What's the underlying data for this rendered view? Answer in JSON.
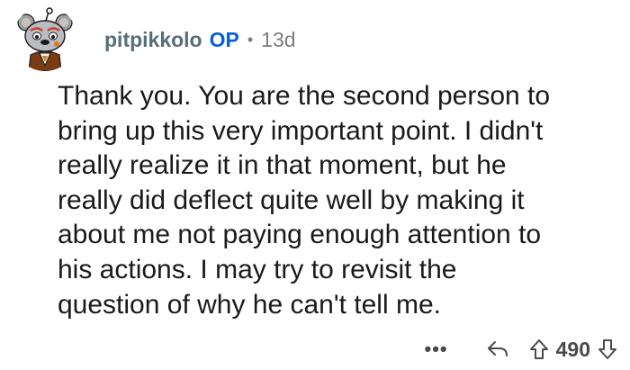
{
  "comment": {
    "author": "pitpikkolo",
    "op_badge": "OP",
    "separator": "•",
    "age": "13d",
    "body": "Thank you. You are the second person to\nbring up this very important point. I didn't\nreally realize it in that moment, but he\nreally did deflect quite well by making it\nabout me not paying enough attention to\nhis actions. I may try to revisit the\nquestion of why he can't tell me.",
    "avatar_icon": "snoo-avatar-icon"
  },
  "actions": {
    "more_label": "•••",
    "reply_icon": "reply-icon",
    "upvote_icon": "upvote-arrow-icon",
    "score": "490",
    "downvote_icon": "downvote-arrow-icon"
  },
  "colors": {
    "username": "#576f76",
    "op_badge": "#0a5fd6",
    "meta": "#7c7c7c",
    "text": "#1a1a1b",
    "icon": "#4a4a4a"
  }
}
